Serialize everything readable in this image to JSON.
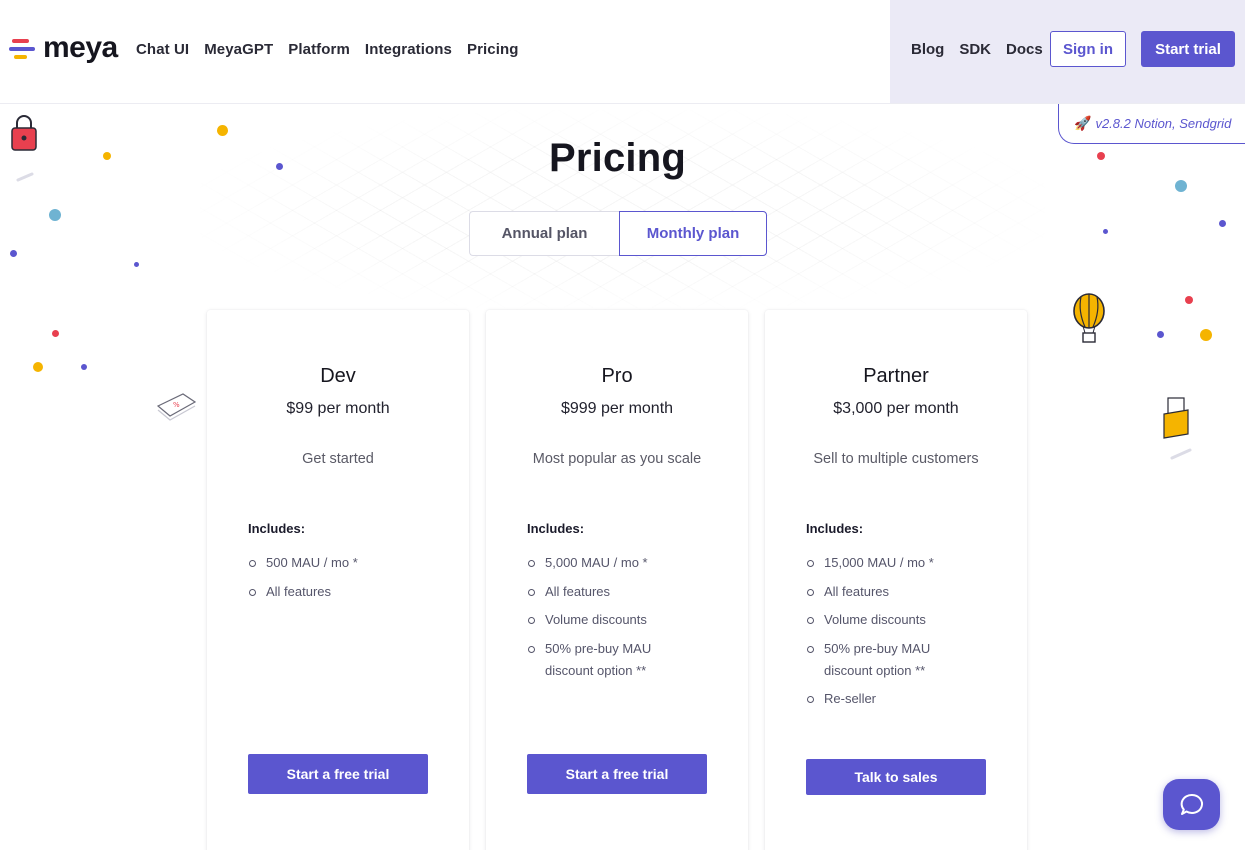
{
  "header": {
    "logo_text": "meya",
    "nav_left": [
      "Chat UI",
      "MeyaGPT",
      "Platform",
      "Integrations",
      "Pricing"
    ],
    "nav_right": [
      "Blog",
      "SDK",
      "Docs"
    ],
    "signin_label": "Sign in",
    "start_trial_label": "Start trial"
  },
  "version_banner": {
    "icon": "rocket-icon",
    "text": "v2.8.2 Notion, Sendgrid"
  },
  "page": {
    "title": "Pricing",
    "plan_toggle": {
      "options": [
        "Annual plan",
        "Monthly plan"
      ],
      "selected": "Monthly plan"
    }
  },
  "plans": [
    {
      "name": "Dev",
      "price": "$99 per month",
      "tagline": "Get started",
      "includes_label": "Includes:",
      "features": [
        "500 MAU / mo *",
        "All features"
      ],
      "cta": "Start a free trial"
    },
    {
      "name": "Pro",
      "price": "$999 per month",
      "tagline": "Most popular as you scale",
      "includes_label": "Includes:",
      "features": [
        "5,000 MAU / mo *",
        "All features",
        "Volume discounts",
        "50% pre-buy MAU discount option **"
      ],
      "cta": "Start a free trial"
    },
    {
      "name": "Partner",
      "price": "$3,000 per month",
      "tagline": "Sell to multiple customers",
      "includes_label": "Includes:",
      "features": [
        "15,000 MAU / mo *",
        "All features",
        "Volume discounts",
        "50% pre-buy MAU discount option **",
        "Re-seller"
      ],
      "cta": "Talk to sales"
    }
  ],
  "chat_launcher": {
    "icon": "chat-bubble-icon"
  },
  "colors": {
    "accent": "#5b56cf",
    "header_right_bg": "#ebeaf6",
    "logo_red": "#e8404f",
    "logo_yellow": "#f5b400",
    "dot_blue": "#6fb3d2"
  }
}
